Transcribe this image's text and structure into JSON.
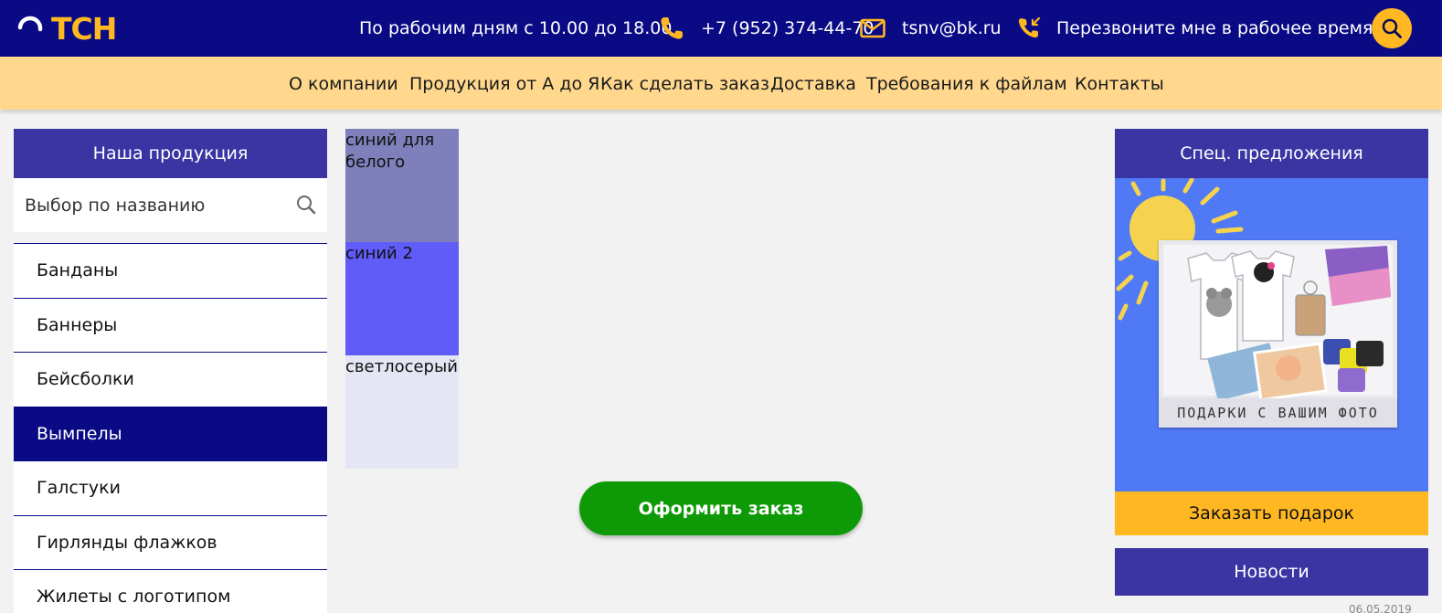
{
  "header": {
    "logo_text": "ТСН",
    "hours": "По рабочим дням с 10.00 до 18.00",
    "phone": "+7 (952) 374-44-70",
    "email": "tsnv@bk.ru",
    "callback": "Перезвоните мне в рабочее время",
    "icons": [
      "phone-icon",
      "mail-icon",
      "callback-icon",
      "search-icon"
    ]
  },
  "nav": {
    "items": [
      "О компании",
      "Продукция от А до Я",
      "Как сделать заказ",
      "Доставка",
      "Требования к файлам",
      "Контакты"
    ]
  },
  "sidebar": {
    "title": "Наша продукция",
    "search_placeholder": "Выбор по названию",
    "items": [
      "Банданы",
      "Баннеры",
      "Бейсболки",
      "Вымпелы",
      "Галстуки",
      "Гирлянды флажков",
      "Жилеты с логотипом"
    ],
    "active_item": "Вымпелы"
  },
  "swatches": [
    {
      "label": "синий для белого",
      "color": "#7f7fbb"
    },
    {
      "label": "синий 2",
      "color": "#5f5cf7"
    },
    {
      "label": "светлосерый",
      "color": "#e4e6f3"
    }
  ],
  "order_button": "Оформить заказ",
  "right": {
    "offers_title": "Спец. предложения",
    "promo_caption": "ПОДАРКИ С ВАШИМ ФОТО",
    "promo_button": "Заказать подарок",
    "news_title": "Новости",
    "news_date": "06.05.2019"
  },
  "colors": {
    "header_bg": "#0a0a85",
    "accent": "#ffb822",
    "nav_bg": "#ffd88e",
    "panel_head": "#3a35a3",
    "order_green": "#0d9a06",
    "promo_blue": "#5079f5"
  }
}
